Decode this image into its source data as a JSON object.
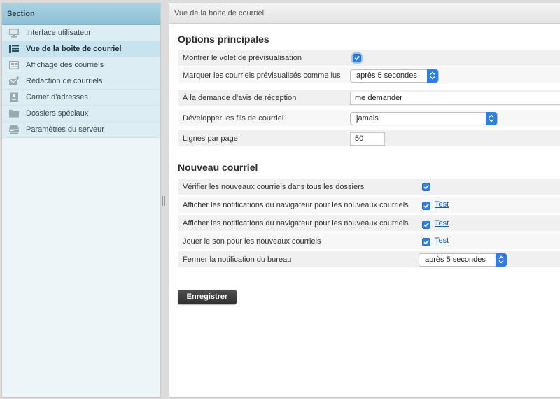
{
  "sidebar": {
    "title": "Section",
    "items": [
      {
        "label": "Interface utilisateur",
        "icon": "monitor-icon",
        "selected": false
      },
      {
        "label": "Vue de la boîte de courriel",
        "icon": "layout-list-icon",
        "selected": true
      },
      {
        "label": "Affichage des courriels",
        "icon": "message-view-icon",
        "selected": false
      },
      {
        "label": "Rédaction de courriels",
        "icon": "compose-icon",
        "selected": false
      },
      {
        "label": "Carnet d'adresses",
        "icon": "address-book-icon",
        "selected": false
      },
      {
        "label": "Dossiers spéciaux",
        "icon": "folder-icon",
        "selected": false
      },
      {
        "label": "Paramètres du serveur",
        "icon": "server-icon",
        "selected": false
      }
    ]
  },
  "main": {
    "title": "Vue de la boîte de courriel",
    "main_options": {
      "title": "Options principales",
      "preview_pane_label": "Montrer le volet de prévisualisation",
      "preview_pane_checked": true,
      "mark_read_label": "Marquer les courriels prévisualisés comme lus",
      "mark_read_value": "après 5 secondes",
      "receipt_label": "À la demande d'avis de réception",
      "receipt_value": "me demander",
      "threads_label": "Développer les fils de courriel",
      "threads_value": "jamais",
      "rows_label": "Lignes par page",
      "rows_value": "50"
    },
    "new_mail": {
      "title": "Nouveau courriel",
      "check_all_label": "Vérifier les nouveaux courriels dans tous les dossiers",
      "check_all_checked": true,
      "notify_label_1": "Afficher les notifications du navigateur pour les nouveaux courriels",
      "notify_checked_1": true,
      "notify_label_2": "Afficher les notifications du navigateur pour les nouveaux courriels",
      "notify_checked_2": true,
      "sound_label": "Jouer le son pour les nouveaux courriels",
      "sound_checked": true,
      "test_link": "Test",
      "close_notification_label": "Fermer la notification du bureau",
      "close_notification_value": "après 5 secondes"
    },
    "save_label": "Enregistrer"
  },
  "colors": {
    "accent": "#2f7fe0",
    "sidebar_header": "#a8d2e3",
    "sidebar_selected": "#c6e3ef",
    "save_button": "#3a3a3a"
  }
}
